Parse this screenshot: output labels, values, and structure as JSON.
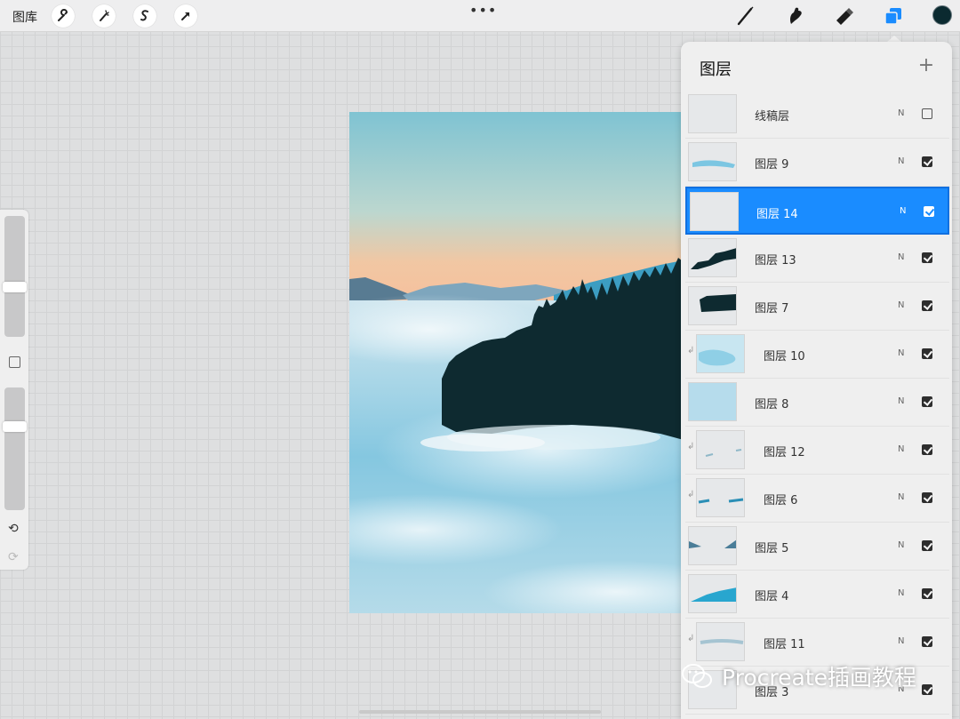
{
  "toolbar": {
    "gallery_label": "图库",
    "left_tools": [
      "wrench-icon",
      "magic-wand-icon",
      "selection-icon",
      "transform-arrow-icon"
    ],
    "right_tools": [
      "brush-icon",
      "smudge-icon",
      "eraser-icon",
      "layers-icon"
    ],
    "current_color": "#0b2a30",
    "active_accent": "#1a8cff"
  },
  "sidebar": {
    "brush_size_level": 0.4,
    "opacity_level": 0.7,
    "undo_icon": "undo-icon",
    "redo_icon": "redo-icon"
  },
  "layers_panel": {
    "title": "图层",
    "add_icon": "plus-icon",
    "layers": [
      {
        "name": "线稿层",
        "blend": "N",
        "visible": false,
        "active": false,
        "clipped": false,
        "thumb": "blank"
      },
      {
        "name": "图层 9",
        "blend": "N",
        "visible": true,
        "active": false,
        "clipped": false,
        "thumb": "blue-stroke"
      },
      {
        "name": "图层 14",
        "blend": "N",
        "visible": true,
        "active": true,
        "clipped": false,
        "thumb": "blank"
      },
      {
        "name": "图层 13",
        "blend": "N",
        "visible": true,
        "active": false,
        "clipped": false,
        "thumb": "dark-ridge"
      },
      {
        "name": "图层 7",
        "blend": "N",
        "visible": true,
        "active": false,
        "clipped": false,
        "thumb": "dark-block"
      },
      {
        "name": "图层 10",
        "blend": "N",
        "visible": true,
        "active": false,
        "clipped": true,
        "thumb": "blue-cloud"
      },
      {
        "name": "图层 8",
        "blend": "N",
        "visible": true,
        "active": false,
        "clipped": false,
        "thumb": "light-blue"
      },
      {
        "name": "图层 12",
        "blend": "N",
        "visible": true,
        "active": false,
        "clipped": true,
        "thumb": "faint-specks"
      },
      {
        "name": "图层 6",
        "blend": "N",
        "visible": true,
        "active": false,
        "clipped": true,
        "thumb": "blue-dashes"
      },
      {
        "name": "图层 5",
        "blend": "N",
        "visible": true,
        "active": false,
        "clipped": false,
        "thumb": "corner-hills"
      },
      {
        "name": "图层 4",
        "blend": "N",
        "visible": true,
        "active": false,
        "clipped": false,
        "thumb": "blue-mountain"
      },
      {
        "name": "图层 11",
        "blend": "N",
        "visible": true,
        "active": false,
        "clipped": true,
        "thumb": "faint-stroke"
      },
      {
        "name": "图层 3",
        "blend": "N",
        "visible": true,
        "active": false,
        "clipped": false,
        "thumb": "blank"
      }
    ]
  },
  "watermark": {
    "text": "Procreate插画教程",
    "icon": "wechat-icon"
  }
}
